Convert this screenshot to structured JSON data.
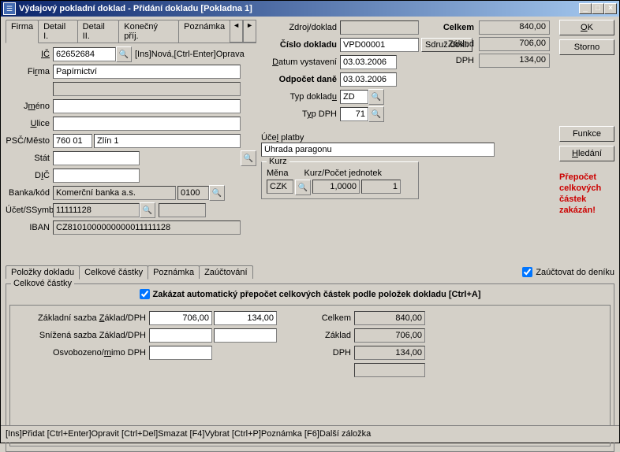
{
  "window": {
    "title": "Výdajový pokladní doklad - Přidání dokladu  [Pokladna 1]"
  },
  "tabs_main": [
    "Firma",
    "Detail I.",
    "Detail II.",
    "Konečný příj.",
    "Poznámka"
  ],
  "left": {
    "ic_label": "IČ",
    "ic": "62652684",
    "ic_hint": "[Ins]Nová,[Ctrl-Enter]Oprava",
    "firma_label": "Firma",
    "firma": "Papírnictví",
    "jmeno_label": "Jméno",
    "jmeno": "",
    "ulice_label": "Ulice",
    "ulice": "",
    "psc_label": "PSČ/Město",
    "psc": "760 01",
    "mesto": "Zlín 1",
    "stat_label": "Stát",
    "stat": "",
    "dic_label": "DIČ",
    "dic": "",
    "banka_label": "Banka/kód",
    "banka": "Komerční banka a.s.",
    "bkod": "0100",
    "ucet_label": "Účet/SSymb",
    "ucet": "11111128",
    "ssymb": "",
    "iban_label": "IBAN",
    "iban": "CZ8101000000000011111128"
  },
  "right": {
    "zdroj_label": "Zdroj/doklad",
    "zdroj": "",
    "cislo_label": "Číslo dokladu",
    "cislo": "VPD00001",
    "sdruz_btn": "Sdruž.dokl.",
    "datum_label": "Datum vystavení",
    "datum": "03.03.2006",
    "odpocet_label": "Odpočet daně",
    "odpocet": "03.03.2006",
    "typdok_label": "Typ dokladu",
    "typdok": "ZD",
    "typdph_label": "Typ DPH",
    "typdph": "71",
    "ucel_label": "Účel platby",
    "ucel": "Úhrada paragonu",
    "kurz_legend": "Kurz",
    "mena_label": "Měna",
    "kurzpj_label": "Kurz/Počet jednotek",
    "mena": "CZK",
    "kurz": "1,0000",
    "pocet": "1"
  },
  "totals": {
    "celkem_label": "Celkem",
    "celkem": "840,00",
    "zaklad_label": "Základ",
    "zaklad": "706,00",
    "dph_label": "DPH",
    "dph": "134,00"
  },
  "side": {
    "ok": "OK",
    "storno": "Storno",
    "funkce": "Funkce",
    "hledani": "Hledání",
    "warning": "Přepočet celkových částek zakázán!"
  },
  "lower_tabs": [
    "Položky dokladu",
    "Celkové částky",
    "Poznámka",
    "Zaúčtování"
  ],
  "lower_chk1": "Zaúčtovat do deníku",
  "lower_chk2": "Zakázat automatický přepočet celkových částek podle položek dokladu [Ctrl+A]",
  "sub_legend": "Celkové částky",
  "rates": {
    "r1_label": "Základní sazba Základ/DPH",
    "r1a": "706,00",
    "r1b": "134,00",
    "r2_label": "Snížená sazba Základ/DPH",
    "r2a": "",
    "r2b": "",
    "r3_label": "Osvobozeno/mimo DPH",
    "r3a": ""
  },
  "summary": {
    "celkem_label": "Celkem",
    "celkem": "840,00",
    "zaklad_label": "Základ",
    "zaklad": "706,00",
    "dph_label": "DPH",
    "dph": "134,00"
  },
  "status": "[Ins]Přidat [Ctrl+Enter]Opravit [Ctrl+Del]Smazat [F4]Vybrat [Ctrl+P]Poznámka [F6]Další záložka"
}
